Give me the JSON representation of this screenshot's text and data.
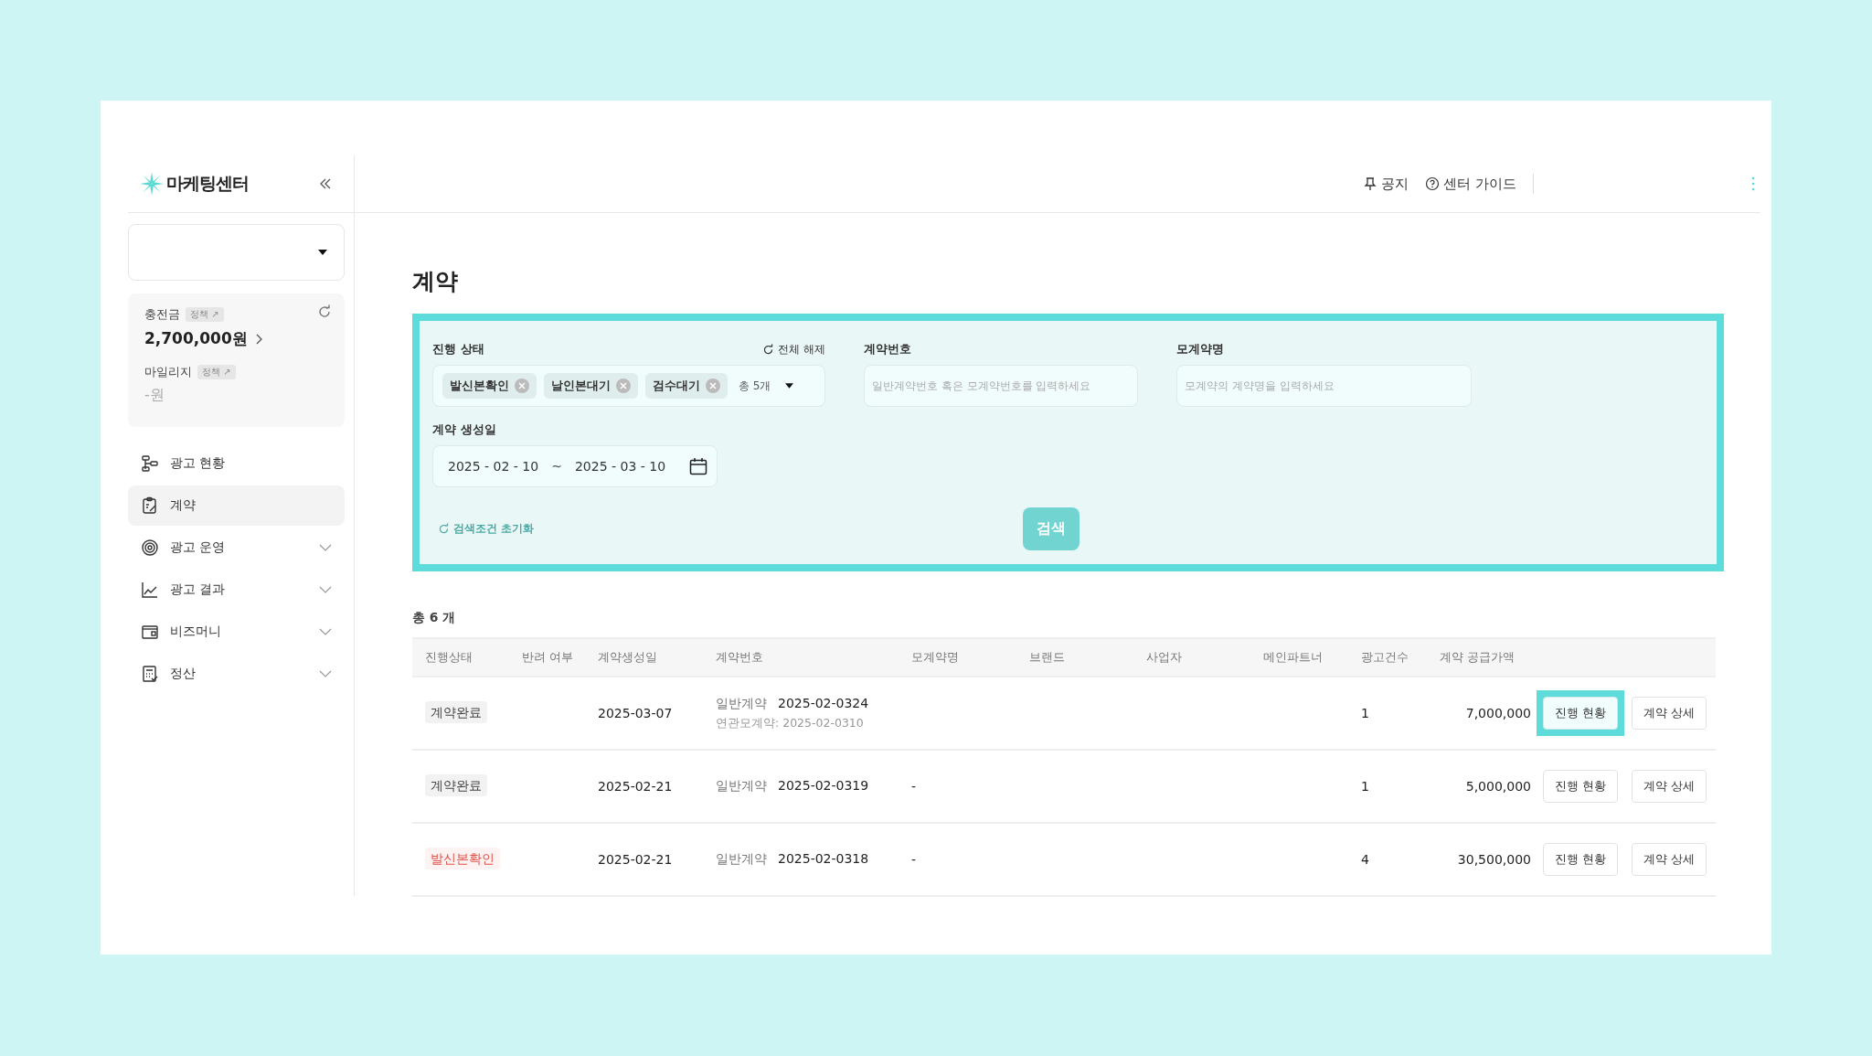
{
  "sidebar": {
    "logo": "마케팅센터",
    "balance": {
      "charge_label": "충전금",
      "charge_tag": "정책 ↗",
      "charge_value": "2,700,000원",
      "mileage_label": "마일리지",
      "mileage_tag": "정책 ↗",
      "mileage_value": "-원"
    },
    "items": [
      {
        "label": "광고 현황",
        "selected": false,
        "expandable": false
      },
      {
        "label": "계약",
        "selected": true,
        "expandable": false
      },
      {
        "label": "광고 운영",
        "selected": false,
        "expandable": true
      },
      {
        "label": "광고 결과",
        "selected": false,
        "expandable": true
      },
      {
        "label": "비즈머니",
        "selected": false,
        "expandable": true
      },
      {
        "label": "정산",
        "selected": false,
        "expandable": true
      }
    ]
  },
  "header": {
    "links": [
      "공지",
      "센터 가이드"
    ]
  },
  "page_title": "계약",
  "filter": {
    "highlighted": true,
    "status": {
      "label": "진행 상태",
      "clear": "전체 해제",
      "chips": [
        "발신본확인",
        "날인본대기",
        "검수대기"
      ],
      "count": "총 5개"
    },
    "contract_no": {
      "label": "계약번호",
      "placeholder": "일반계약번호 혹은 모계약번호를 입력하세요"
    },
    "parent_name": {
      "label": "모계약명",
      "placeholder": "모계약의 계약명을 입력하세요"
    },
    "date": {
      "label": "계약 생성일",
      "from": "2025 - 02 - 10",
      "sep": "~",
      "to": "2025 - 03 - 10"
    },
    "reset": "검색조건 초기화",
    "search": "검색"
  },
  "total": "총 6 개",
  "table": {
    "columns": [
      "진행상태",
      "반려 여부",
      "계약생성일",
      "계약번호",
      "모계약명",
      "브랜드",
      "사업자",
      "메인파트너",
      "광고건수",
      "계약 공급가액"
    ],
    "rows": [
      {
        "status": "계약완료",
        "color": "#444444",
        "date": "2025-03-07",
        "type": "일반계약",
        "number": "2025-02-0324",
        "related": "연관모계약: 2025-02-0310",
        "count": "1",
        "amount": "7,000,000",
        "progress": {
          "label": "진행 현황",
          "highlighted": true
        },
        "detail": "계약 상세"
      },
      {
        "status": "계약완료",
        "color": "#444444",
        "date": "2025-02-21",
        "type": "일반계약",
        "number": "2025-02-0319",
        "parent": "-",
        "count": "1",
        "amount": "5,000,000",
        "progress": {
          "label": "진행 현황",
          "highlighted": false
        },
        "detail": "계약 상세"
      },
      {
        "status": "발신본확인",
        "color": "#e0524a",
        "date": "2025-02-21",
        "type": "일반계약",
        "number": "2025-02-0318",
        "parent": "-",
        "count": "4",
        "amount": "30,500,000",
        "progress": {
          "label": "진행 현황",
          "highlighted": false
        },
        "detail": "계약 상세"
      }
    ]
  }
}
